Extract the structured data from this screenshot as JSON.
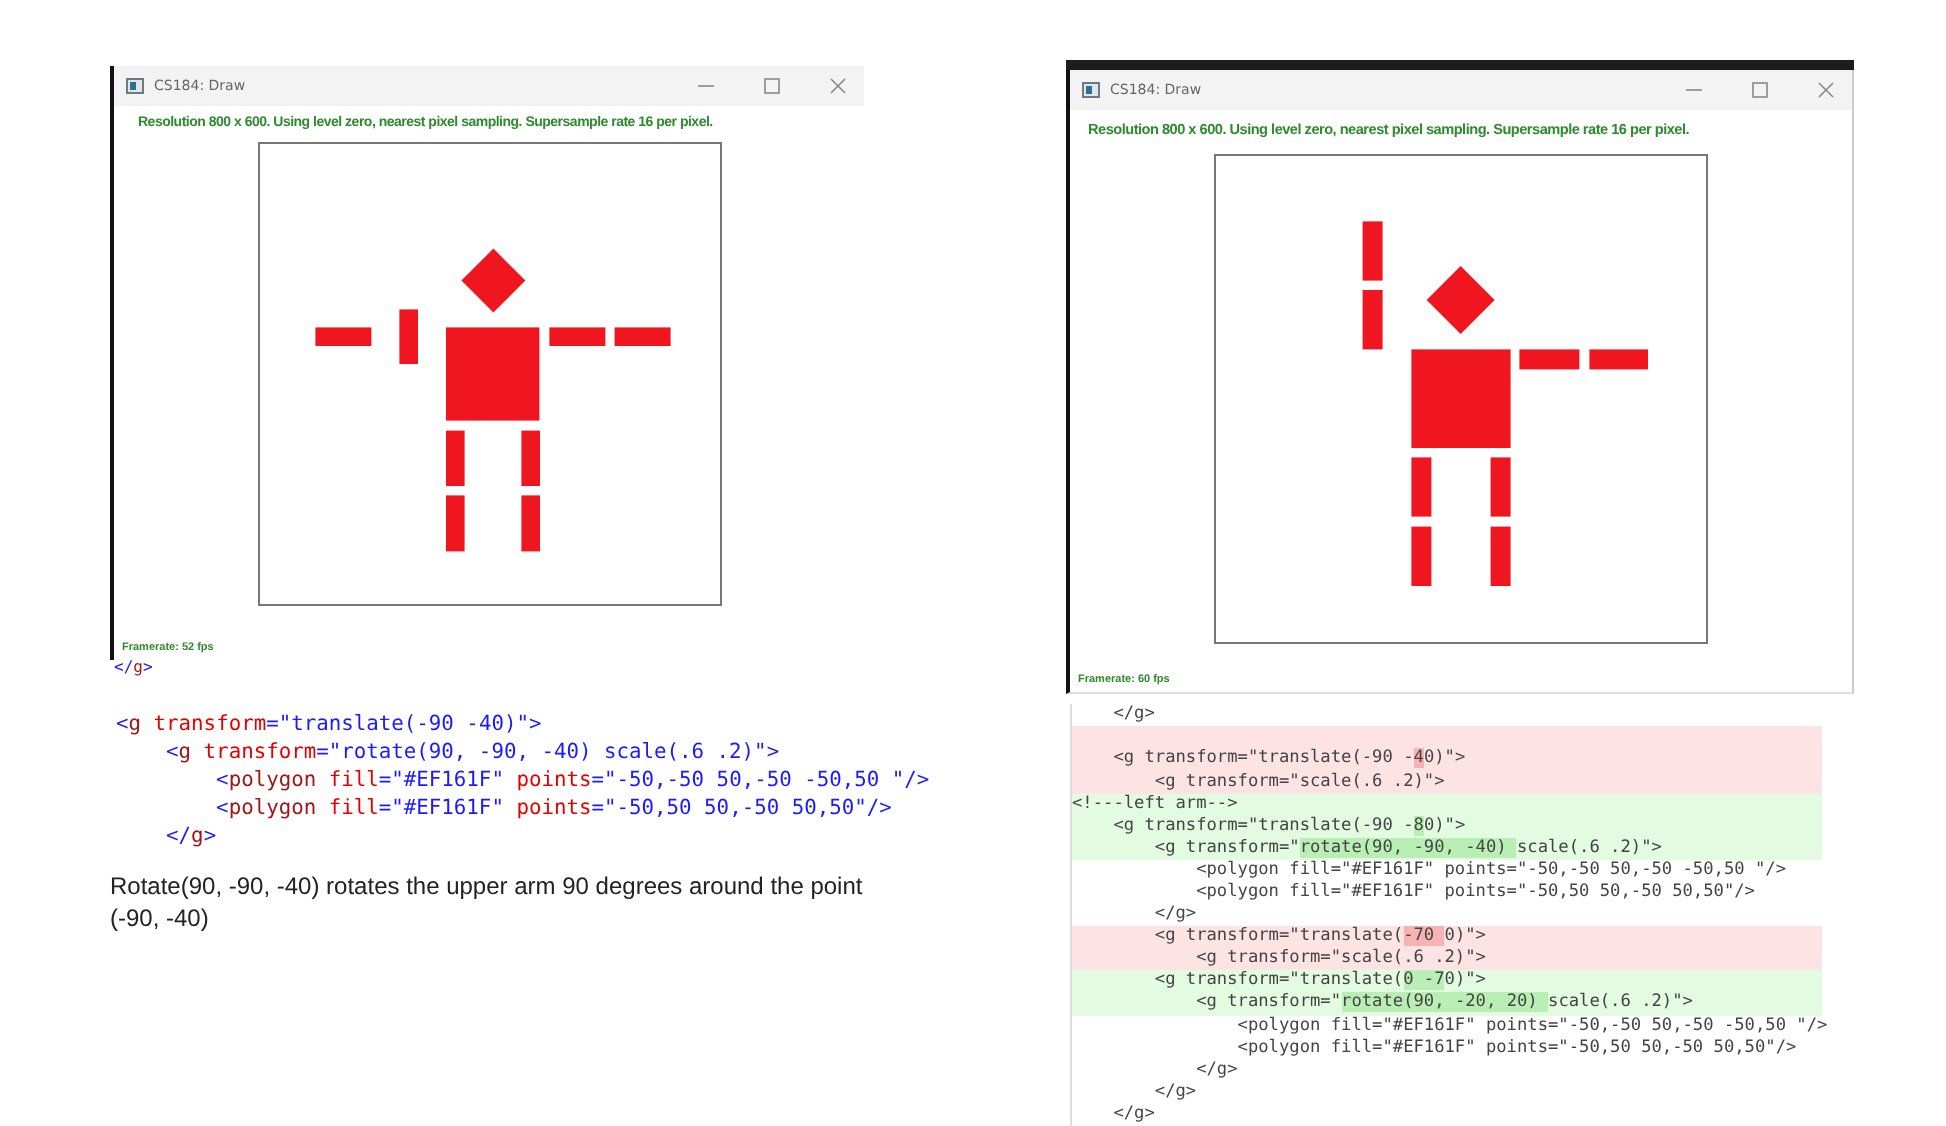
{
  "left_panel": {
    "window": {
      "title": "CS184: Draw",
      "figure": {
        "kind": "arms-out"
      },
      "status": "Resolution 800 x 600. Using level zero, nearest pixel sampling. Supersample rate 16 per pixel.",
      "framerate": "Framerate: 52 fps"
    },
    "code_tail": [
      {
        "kind": "value",
        "t": "</"
      },
      {
        "kind": "tag",
        "t": "g"
      },
      {
        "kind": "value",
        "t": ">"
      }
    ],
    "code": [
      [
        {
          "kind": "value",
          "t": "<"
        },
        {
          "kind": "tag",
          "t": "g"
        },
        {
          "kind": "attr",
          "t": " transform"
        },
        {
          "kind": "value",
          "t": "=\"translate(-90 -40)\">"
        }
      ],
      [
        {
          "kind": "value",
          "t": "    <"
        },
        {
          "kind": "tag",
          "t": "g"
        },
        {
          "kind": "attr",
          "t": " transform"
        },
        {
          "kind": "value",
          "t": "=\"rotate(90, -90, -40) scale(.6 .2)\">"
        }
      ],
      [
        {
          "kind": "value",
          "t": "        <"
        },
        {
          "kind": "tag",
          "t": "polygon"
        },
        {
          "kind": "attr",
          "t": " fill"
        },
        {
          "kind": "value",
          "t": "=\"#EF161F\""
        },
        {
          "kind": "attr",
          "t": " points"
        },
        {
          "kind": "value",
          "t": "=\"-50,-50 50,-50 -50,50 \"/>"
        }
      ],
      [
        {
          "kind": "value",
          "t": "        <"
        },
        {
          "kind": "tag",
          "t": "polygon"
        },
        {
          "kind": "attr",
          "t": " fill"
        },
        {
          "kind": "value",
          "t": "=\"#EF161F\""
        },
        {
          "kind": "attr",
          "t": " points"
        },
        {
          "kind": "value",
          "t": "=\"-50,50 50,-50 50,50\"/>"
        }
      ],
      [
        {
          "kind": "value",
          "t": "    </"
        },
        {
          "kind": "tag",
          "t": "g"
        },
        {
          "kind": "value",
          "t": ">"
        }
      ]
    ],
    "caption": "Rotate(90, -90, -40) rotates the upper arm 90 degrees around the point (-90, -40)"
  },
  "right_panel": {
    "window": {
      "title": "CS184: Draw",
      "figure": {
        "kind": "arm-raised"
      },
      "status": "Resolution 800 x 600. Using level zero, nearest pixel sampling. Supersample rate 16 per pixel.",
      "framerate": "Framerate: 60 fps"
    },
    "diff": [
      {
        "kind": "context",
        "segs": [
          {
            "t": "    </g>",
            "hl": false
          }
        ]
      },
      {
        "kind": "removed"
      },
      {
        "kind": "removed",
        "segs": [
          {
            "t": "    <g transform=\"translate(-90 -",
            "hl": false
          },
          {
            "t": "4",
            "hl": true
          },
          {
            "t": "0)\">",
            "hl": false
          }
        ]
      },
      {
        "kind": "removed",
        "segs": [
          {
            "t": "        <g transform=\"scale(.6 .2)\">",
            "hl": false
          }
        ]
      },
      {
        "kind": "added",
        "segs": [
          {
            "t": "<!---left arm-->",
            "hl": false
          }
        ]
      },
      {
        "kind": "added",
        "segs": [
          {
            "t": "    <g transform=\"translate(-90 -",
            "hl": false
          },
          {
            "t": "8",
            "hl": true
          },
          {
            "t": "0)\">",
            "hl": false
          }
        ]
      },
      {
        "kind": "added",
        "segs": [
          {
            "t": "        <g transform=\"",
            "hl": false
          },
          {
            "t": "rotate(90, -90, -40) ",
            "hl": true
          },
          {
            "t": "scale(.6 .2)\">",
            "hl": false
          }
        ]
      },
      {
        "kind": "context",
        "segs": [
          {
            "t": "            <polygon fill=\"#EF161F\" points=\"-50,-50 50,-50 -50,50 \"/>",
            "hl": false
          }
        ]
      },
      {
        "kind": "context",
        "segs": [
          {
            "t": "            <polygon fill=\"#EF161F\" points=\"-50,50 50,-50 50,50\"/>",
            "hl": false
          }
        ]
      },
      {
        "kind": "context",
        "segs": [
          {
            "t": "        </g>",
            "hl": false
          }
        ]
      },
      {
        "kind": "removed",
        "segs": [
          {
            "t": "        <g transform=\"translate(",
            "hl": false
          },
          {
            "t": "-70 ",
            "hl": true
          },
          {
            "t": "0)\">",
            "hl": false
          }
        ]
      },
      {
        "kind": "removed",
        "segs": [
          {
            "t": "            <g transform=\"scale(.6 .2)\">",
            "hl": false
          }
        ]
      },
      {
        "kind": "added",
        "segs": [
          {
            "t": "        <g transform=\"translate(",
            "hl": false
          },
          {
            "t": "0 -7",
            "hl": true
          },
          {
            "t": "0)\">",
            "hl": false
          }
        ]
      },
      {
        "kind": "added",
        "segs": [
          {
            "t": "            <g transform=\"",
            "hl": false
          },
          {
            "t": "rotate(90, -20, 20) ",
            "hl": true
          },
          {
            "t": "scale(.6 .2)\">",
            "hl": false
          }
        ]
      },
      {
        "kind": "context",
        "segs": [
          {
            "t": "                <polygon fill=\"#EF161F\" points=\"-50,-50 50,-50 -50,50 \"/>",
            "hl": false
          }
        ]
      },
      {
        "kind": "context",
        "segs": [
          {
            "t": "                <polygon fill=\"#EF161F\" points=\"-50,50 50,-50 50,50\"/>",
            "hl": false
          }
        ]
      },
      {
        "kind": "context",
        "segs": [
          {
            "t": "            </g>",
            "hl": false
          }
        ]
      },
      {
        "kind": "context",
        "segs": [
          {
            "t": "        </g>",
            "hl": false
          }
        ]
      },
      {
        "kind": "context",
        "segs": [
          {
            "t": "    </g>",
            "hl": false
          }
        ]
      }
    ]
  }
}
